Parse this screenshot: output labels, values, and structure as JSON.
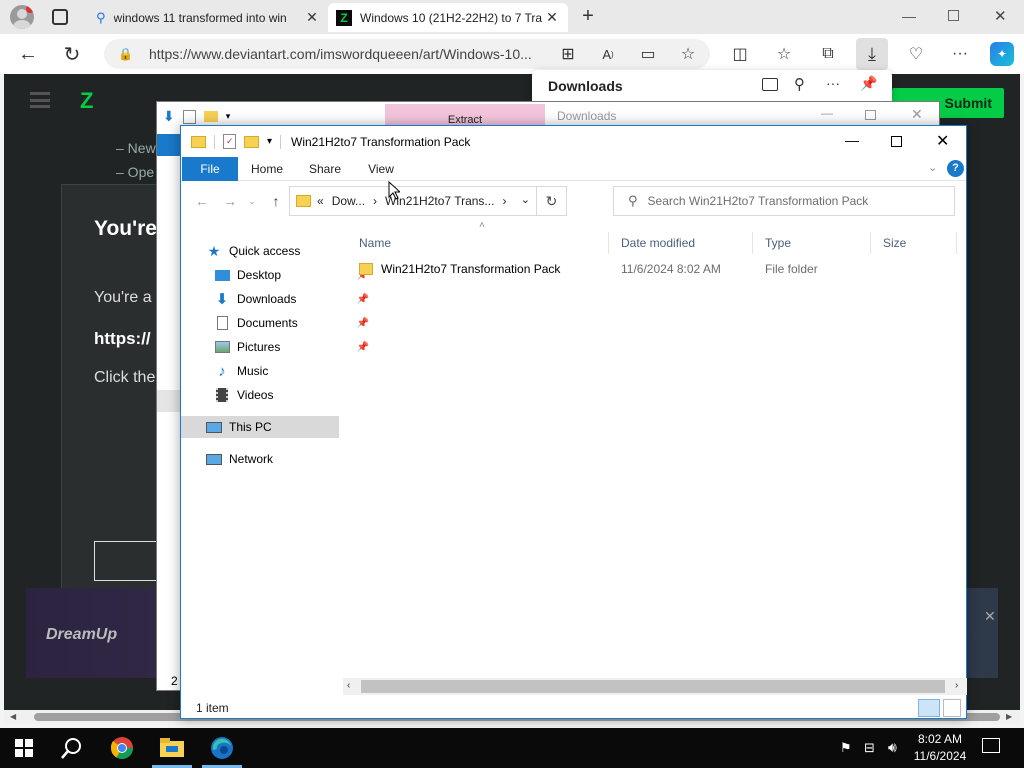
{
  "browser": {
    "tabs": [
      {
        "title": "windows 11 transformed into win",
        "active": false
      },
      {
        "title": "Windows 10 (21H2-22H2) to 7 Tra",
        "active": true
      }
    ],
    "url": "https://www.deviantart.com/imswordqueeen/art/Windows-10..."
  },
  "downloads_panel": {
    "title": "Downloads"
  },
  "page_bg": {
    "submit": "Submit",
    "line1": "– New",
    "line2": "– Ope",
    "heading": "You're",
    "para1": "You're a",
    "para2": "https://",
    "para3": "Click the",
    "dreamup": "DreamUp"
  },
  "back_window": {
    "extract_tab": "Extract",
    "title": "Downloads",
    "status_count": "2 i"
  },
  "explorer": {
    "title": "Win21H2to7 Transformation Pack",
    "ribbon": {
      "file": "File",
      "home": "Home",
      "share": "Share",
      "view": "View"
    },
    "address": {
      "prefix": "«",
      "crumbs": [
        "Dow...",
        "Win21H2to7 Trans..."
      ]
    },
    "search_placeholder": "Search Win21H2to7 Transformation Pack",
    "nav": {
      "quick_access": "Quick access",
      "items": [
        {
          "label": "Desktop",
          "pinned": true
        },
        {
          "label": "Downloads",
          "pinned": true
        },
        {
          "label": "Documents",
          "pinned": true
        },
        {
          "label": "Pictures",
          "pinned": true
        },
        {
          "label": "Music",
          "pinned": false
        },
        {
          "label": "Videos",
          "pinned": false
        }
      ],
      "this_pc": "This PC",
      "network": "Network"
    },
    "columns": {
      "name": "Name",
      "date": "Date modified",
      "type": "Type",
      "size": "Size"
    },
    "files": [
      {
        "name": "Win21H2to7 Transformation Pack",
        "date": "11/6/2024 8:02 AM",
        "type": "File folder",
        "size": ""
      }
    ],
    "status": "1 item"
  },
  "taskbar": {
    "time": "8:02 AM",
    "date": "11/6/2024"
  },
  "colors": {
    "accent": "#1979ca",
    "file_tab": "#1979ca",
    "taskbar": "#0a0a0a",
    "page_bg": "#202424"
  }
}
